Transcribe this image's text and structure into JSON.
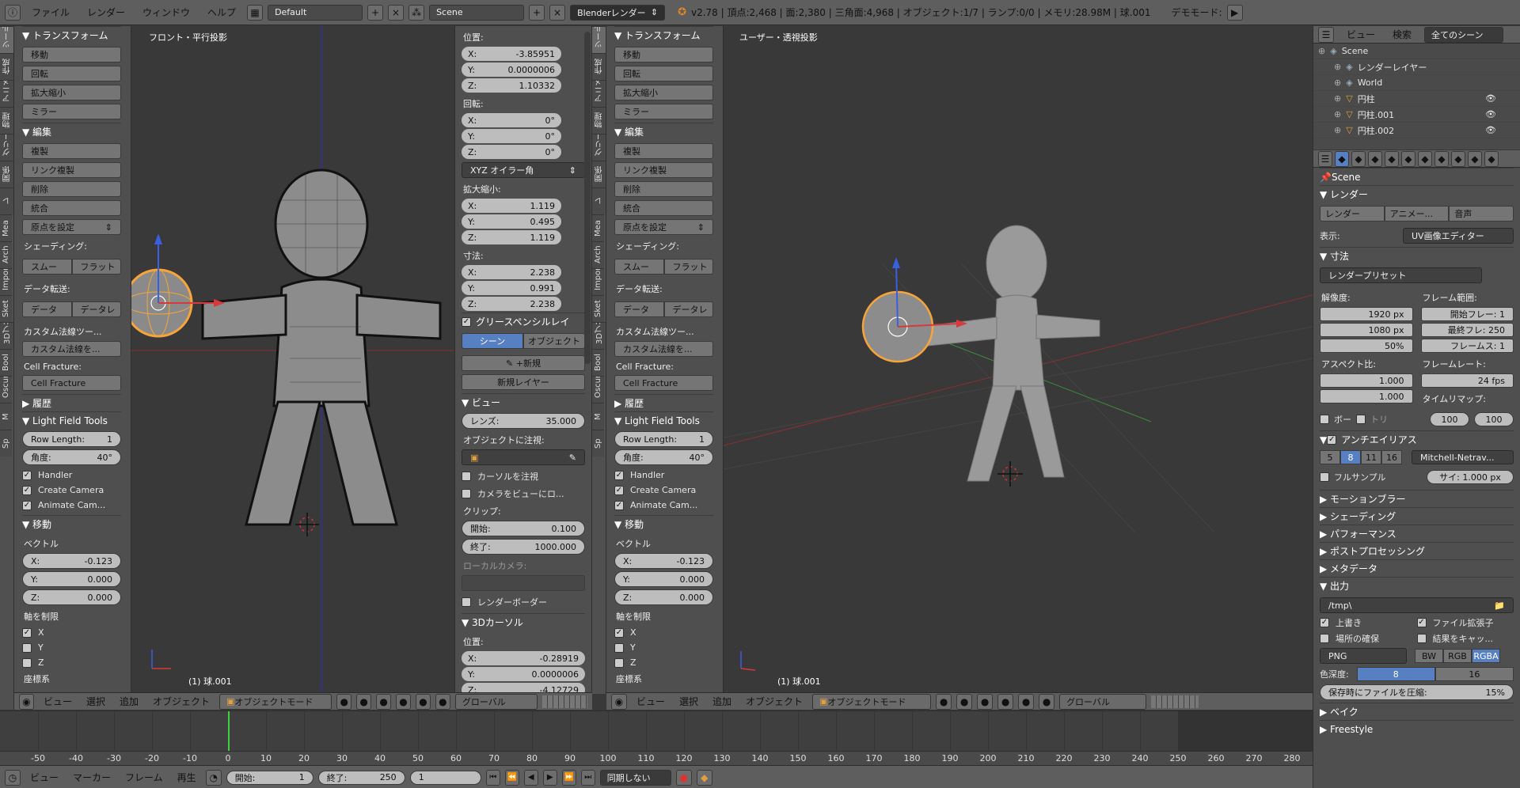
{
  "topbar": {
    "menus": [
      "ファイル",
      "レンダー",
      "ウィンドウ",
      "ヘルプ"
    ],
    "layout": "Default",
    "scene": "Scene",
    "engine": "Blenderレンダー",
    "stats": "v2.78 | 頂点:2,468 | 面:2,380 | 三角面:4,968 | オブジェクト:1/7 | ランプ:0/0 | メモリ:28.98M | 球.001",
    "demo_mode": "デモモード:"
  },
  "toolshelf": {
    "tabs": [
      "ツール",
      "作成",
      "アニメ",
      "物理",
      "グリース",
      "関係",
      "レ",
      "Mea",
      "Arch",
      "Import",
      "Sket",
      "3Dプリ",
      "Bool",
      "Oscura",
      "M",
      "Sp"
    ],
    "transform_header": "▼ トランスフォーム",
    "transform_buttons": [
      "移動",
      "回転",
      "拡大縮小"
    ],
    "mirror": "ミラー",
    "edit_header": "▼ 編集",
    "edit_buttons": [
      "複製",
      "リンク複製",
      "削除"
    ],
    "join": "統合",
    "origin": "原点を設定",
    "shading_label": "シェーディング:",
    "shading_buttons": [
      "スムー",
      "フラット"
    ],
    "data_transfer_label": "データ転送:",
    "data_transfer_buttons": [
      "データ",
      "データレ"
    ],
    "custom_normal_label": "カスタム法線ツー...",
    "custom_normal_button": "カスタム法線を...",
    "cell_fracture_label": "Cell Fracture:",
    "cell_fracture_button": "Cell Fracture",
    "history_header": "▶ 履歴",
    "lft_header": "▼ Light Field Tools",
    "row_length_label": "Row Length:",
    "row_length_value": "1",
    "angle_label": "角度:",
    "angle_value": "40°",
    "handler": "Handler",
    "create_camera": "Create Camera",
    "animate_camera": "Animate Cam...",
    "move_header": "▼ 移動",
    "vector_label": "ベクトル",
    "vx_label": "X:",
    "vx": "-0.123",
    "vy_label": "Y:",
    "vy": "0.000",
    "vz_label": "Z:",
    "vz": "0.000",
    "constraint_label": "軸を制限",
    "ax": "X",
    "ay": "Y",
    "az": "Z",
    "coord_label": "座標系"
  },
  "viewport_left": {
    "title": "フロント・平行投影",
    "object": "(1) 球.001"
  },
  "viewport_right": {
    "title": "ユーザー・透視投影",
    "object": "(1) 球.001"
  },
  "npanel": {
    "location_label": "位置:",
    "loc": [
      {
        "axis": "X:",
        "val": "-3.85951"
      },
      {
        "axis": "Y:",
        "val": "0.0000006"
      },
      {
        "axis": "Z:",
        "val": "1.10332"
      }
    ],
    "rotation_label": "回転:",
    "rot": [
      {
        "axis": "X:",
        "val": "0°"
      },
      {
        "axis": "Y:",
        "val": "0°"
      },
      {
        "axis": "Z:",
        "val": "0°"
      }
    ],
    "rot_mode": "XYZ オイラー角",
    "scale_label": "拡大縮小:",
    "scale": [
      {
        "axis": "X:",
        "val": "1.119"
      },
      {
        "axis": "Y:",
        "val": "0.495"
      },
      {
        "axis": "Z:",
        "val": "1.119"
      }
    ],
    "dim_label": "寸法:",
    "dim": [
      {
        "axis": "X:",
        "val": "2.238"
      },
      {
        "axis": "Y:",
        "val": "0.991"
      },
      {
        "axis": "Z:",
        "val": "2.238"
      }
    ],
    "grease_header": "グリースペンシルレイ",
    "scene_btn": "シーン",
    "object_btn": "オブジェクト",
    "new_btn": "新規",
    "new_layer": "新規レイヤー",
    "view_header": "▼ ビュー",
    "lens_label": "レンズ:",
    "lens": "35.000",
    "lock_label": "オブジェクトに注視:",
    "lock_cursor": "カーソルを注視",
    "lock_camera": "カメラをビューにロ...",
    "clip_label": "クリップ:",
    "clip_start_label": "開始:",
    "clip_start": "0.100",
    "clip_end_label": "終了:",
    "clip_end": "1000.000",
    "local_cam": "ローカルカメラ:",
    "render_border": "レンダーボーダー",
    "cursor_header": "▼ 3Dカーソル",
    "cursor_loc_label": "位置:",
    "cursor": [
      {
        "axis": "X:",
        "val": "-0.28919"
      },
      {
        "axis": "Y:",
        "val": "0.0000006"
      },
      {
        "axis": "Z:",
        "val": "-4.12729"
      }
    ]
  },
  "header3d": {
    "menus": [
      "ビュー",
      "選択",
      "追加",
      "オブジェクト"
    ],
    "mode": "オブジェクトモード",
    "orient": "グローバル"
  },
  "timeline": {
    "ticks": [
      "-50",
      "-40",
      "-30",
      "-20",
      "-10",
      "0",
      "10",
      "20",
      "30",
      "40",
      "50",
      "60",
      "70",
      "80",
      "90",
      "100",
      "110",
      "120",
      "130",
      "140",
      "150",
      "160",
      "170",
      "180",
      "190",
      "200",
      "210",
      "220",
      "230",
      "240",
      "250",
      "260",
      "270",
      "280"
    ],
    "menus": [
      "ビュー",
      "マーカー",
      "フレーム",
      "再生"
    ],
    "start_label": "開始:",
    "start": "1",
    "end_label": "終了:",
    "end": "250",
    "current": "1",
    "sync": "同期しない"
  },
  "outliner": {
    "menus": [
      "ビュー",
      "検索"
    ],
    "filter": "全てのシーン",
    "items": [
      {
        "name": "Scene",
        "indent": 0
      },
      {
        "name": "レンダーレイヤー",
        "indent": 1
      },
      {
        "name": "World",
        "indent": 1
      },
      {
        "name": "円柱",
        "indent": 1
      },
      {
        "name": "円柱.001",
        "indent": 1
      },
      {
        "name": "円柱.002",
        "indent": 1
      }
    ]
  },
  "properties": {
    "scene": "Scene",
    "render_header": "▼ レンダー",
    "render_btns": [
      "レンダー",
      "アニメー...",
      "音声"
    ],
    "display_label": "表示:",
    "display": "UV画像エディター",
    "dim_header": "▼ 寸法",
    "preset": "レンダープリセット",
    "res_label": "解像度:",
    "res_x": "1920 px",
    "res_y": "1080 px",
    "res_pct": "50%",
    "frange_label": "フレーム範囲:",
    "fstart": "開始フレー: 1",
    "fend": "最終フレ: 250",
    "fstep": "フレームス: 1",
    "aspect_label": "アスペクト比:",
    "ax": "1.000",
    "ay": "1.000",
    "fps_label": "フレームレート:",
    "fps": "24 fps",
    "remap_label": "タイムリマップ:",
    "remap_old": "100",
    "remap_new": "100",
    "border": "ボー",
    "crop": "トリ",
    "aa_header": "アンチエイリアス",
    "aa_samples": [
      "5",
      "8",
      "11",
      "16"
    ],
    "aa_filter": "Mitchell-Netrav...",
    "full_sample": "フルサンプル",
    "filter_size": "サイ: 1.000 px",
    "collapsed": [
      "▶ モーションブラー",
      "▶ シェーディング",
      "▶ パフォーマンス",
      "▶ ポストプロセッシング",
      "▶ メタデータ"
    ],
    "output_header": "▼ 出力",
    "path": "/tmp\\",
    "overwrite": "上書き",
    "extensions": "ファイル拡張子",
    "placeholders": "場所の確保",
    "cache": "結果をキャッ...",
    "format": "PNG",
    "color_modes": [
      "BW",
      "RGB",
      "RGBA"
    ],
    "depth_label": "色深度:",
    "depth_vals": [
      "8",
      "16"
    ],
    "compress": "保存時にファイルを圧縮:",
    "compress_val": "15%",
    "bake": "▶ ベイク",
    "freestyle": "▶ Freestyle"
  }
}
